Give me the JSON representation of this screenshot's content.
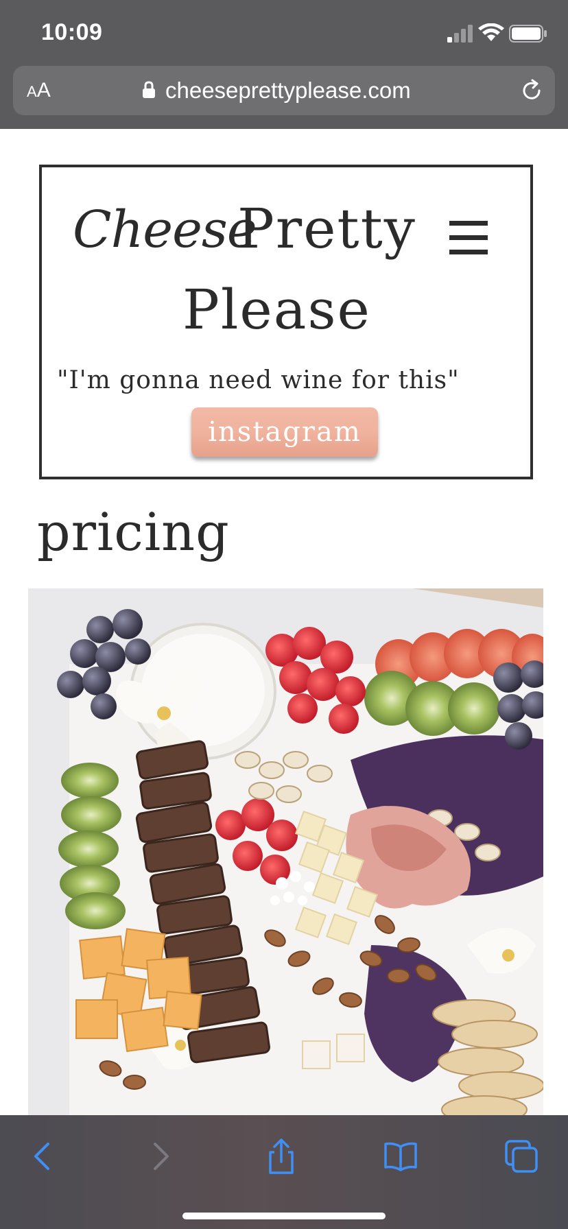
{
  "status_bar": {
    "time": "10:09"
  },
  "browser": {
    "text_size_label_small": "A",
    "text_size_label_large": "A",
    "url": "cheeseprettyplease.com"
  },
  "site": {
    "logo": {
      "script_word": "Cheese",
      "word2": "Pretty",
      "word3": "Please"
    },
    "tagline": "\"I'm gonna need wine for this\"",
    "instagram_label": "instagram",
    "section_title": "pricing"
  },
  "toolbar": {
    "icons": [
      "back-icon",
      "forward-icon",
      "share-icon",
      "bookmarks-icon",
      "tabs-icon"
    ]
  },
  "colors": {
    "chrome": "#5b5b5d",
    "accent_blue": "#3f8ff5",
    "button_peach": "#f0b39e",
    "text_dark": "#2b2b2b"
  }
}
